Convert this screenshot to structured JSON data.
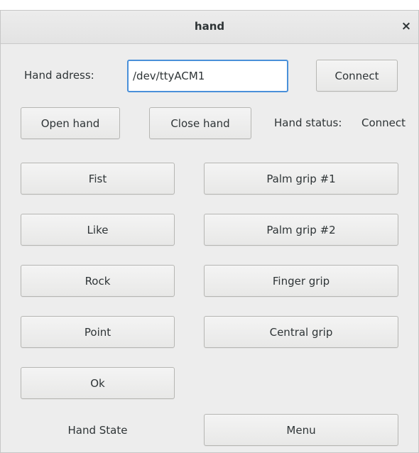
{
  "window": {
    "title": "hand",
    "close_glyph": "×"
  },
  "connection": {
    "address_label": "Hand adress:",
    "address_value": "/dev/ttyACM1",
    "connect_label": "Connect"
  },
  "hand_controls": {
    "open_label": "Open hand",
    "close_label": "Close hand",
    "status_label": "Hand status:",
    "status_value": "Connect"
  },
  "gestures_left": [
    {
      "label": "Fist"
    },
    {
      "label": "Like"
    },
    {
      "label": "Rock"
    },
    {
      "label": "Point"
    },
    {
      "label": "Ok"
    }
  ],
  "grips_right": [
    {
      "label": "Palm grip #1"
    },
    {
      "label": "Palm grip #2"
    },
    {
      "label": "Finger grip"
    },
    {
      "label": "Central grip"
    }
  ],
  "footer": {
    "state_label": "Hand State",
    "menu_label": "Menu"
  }
}
